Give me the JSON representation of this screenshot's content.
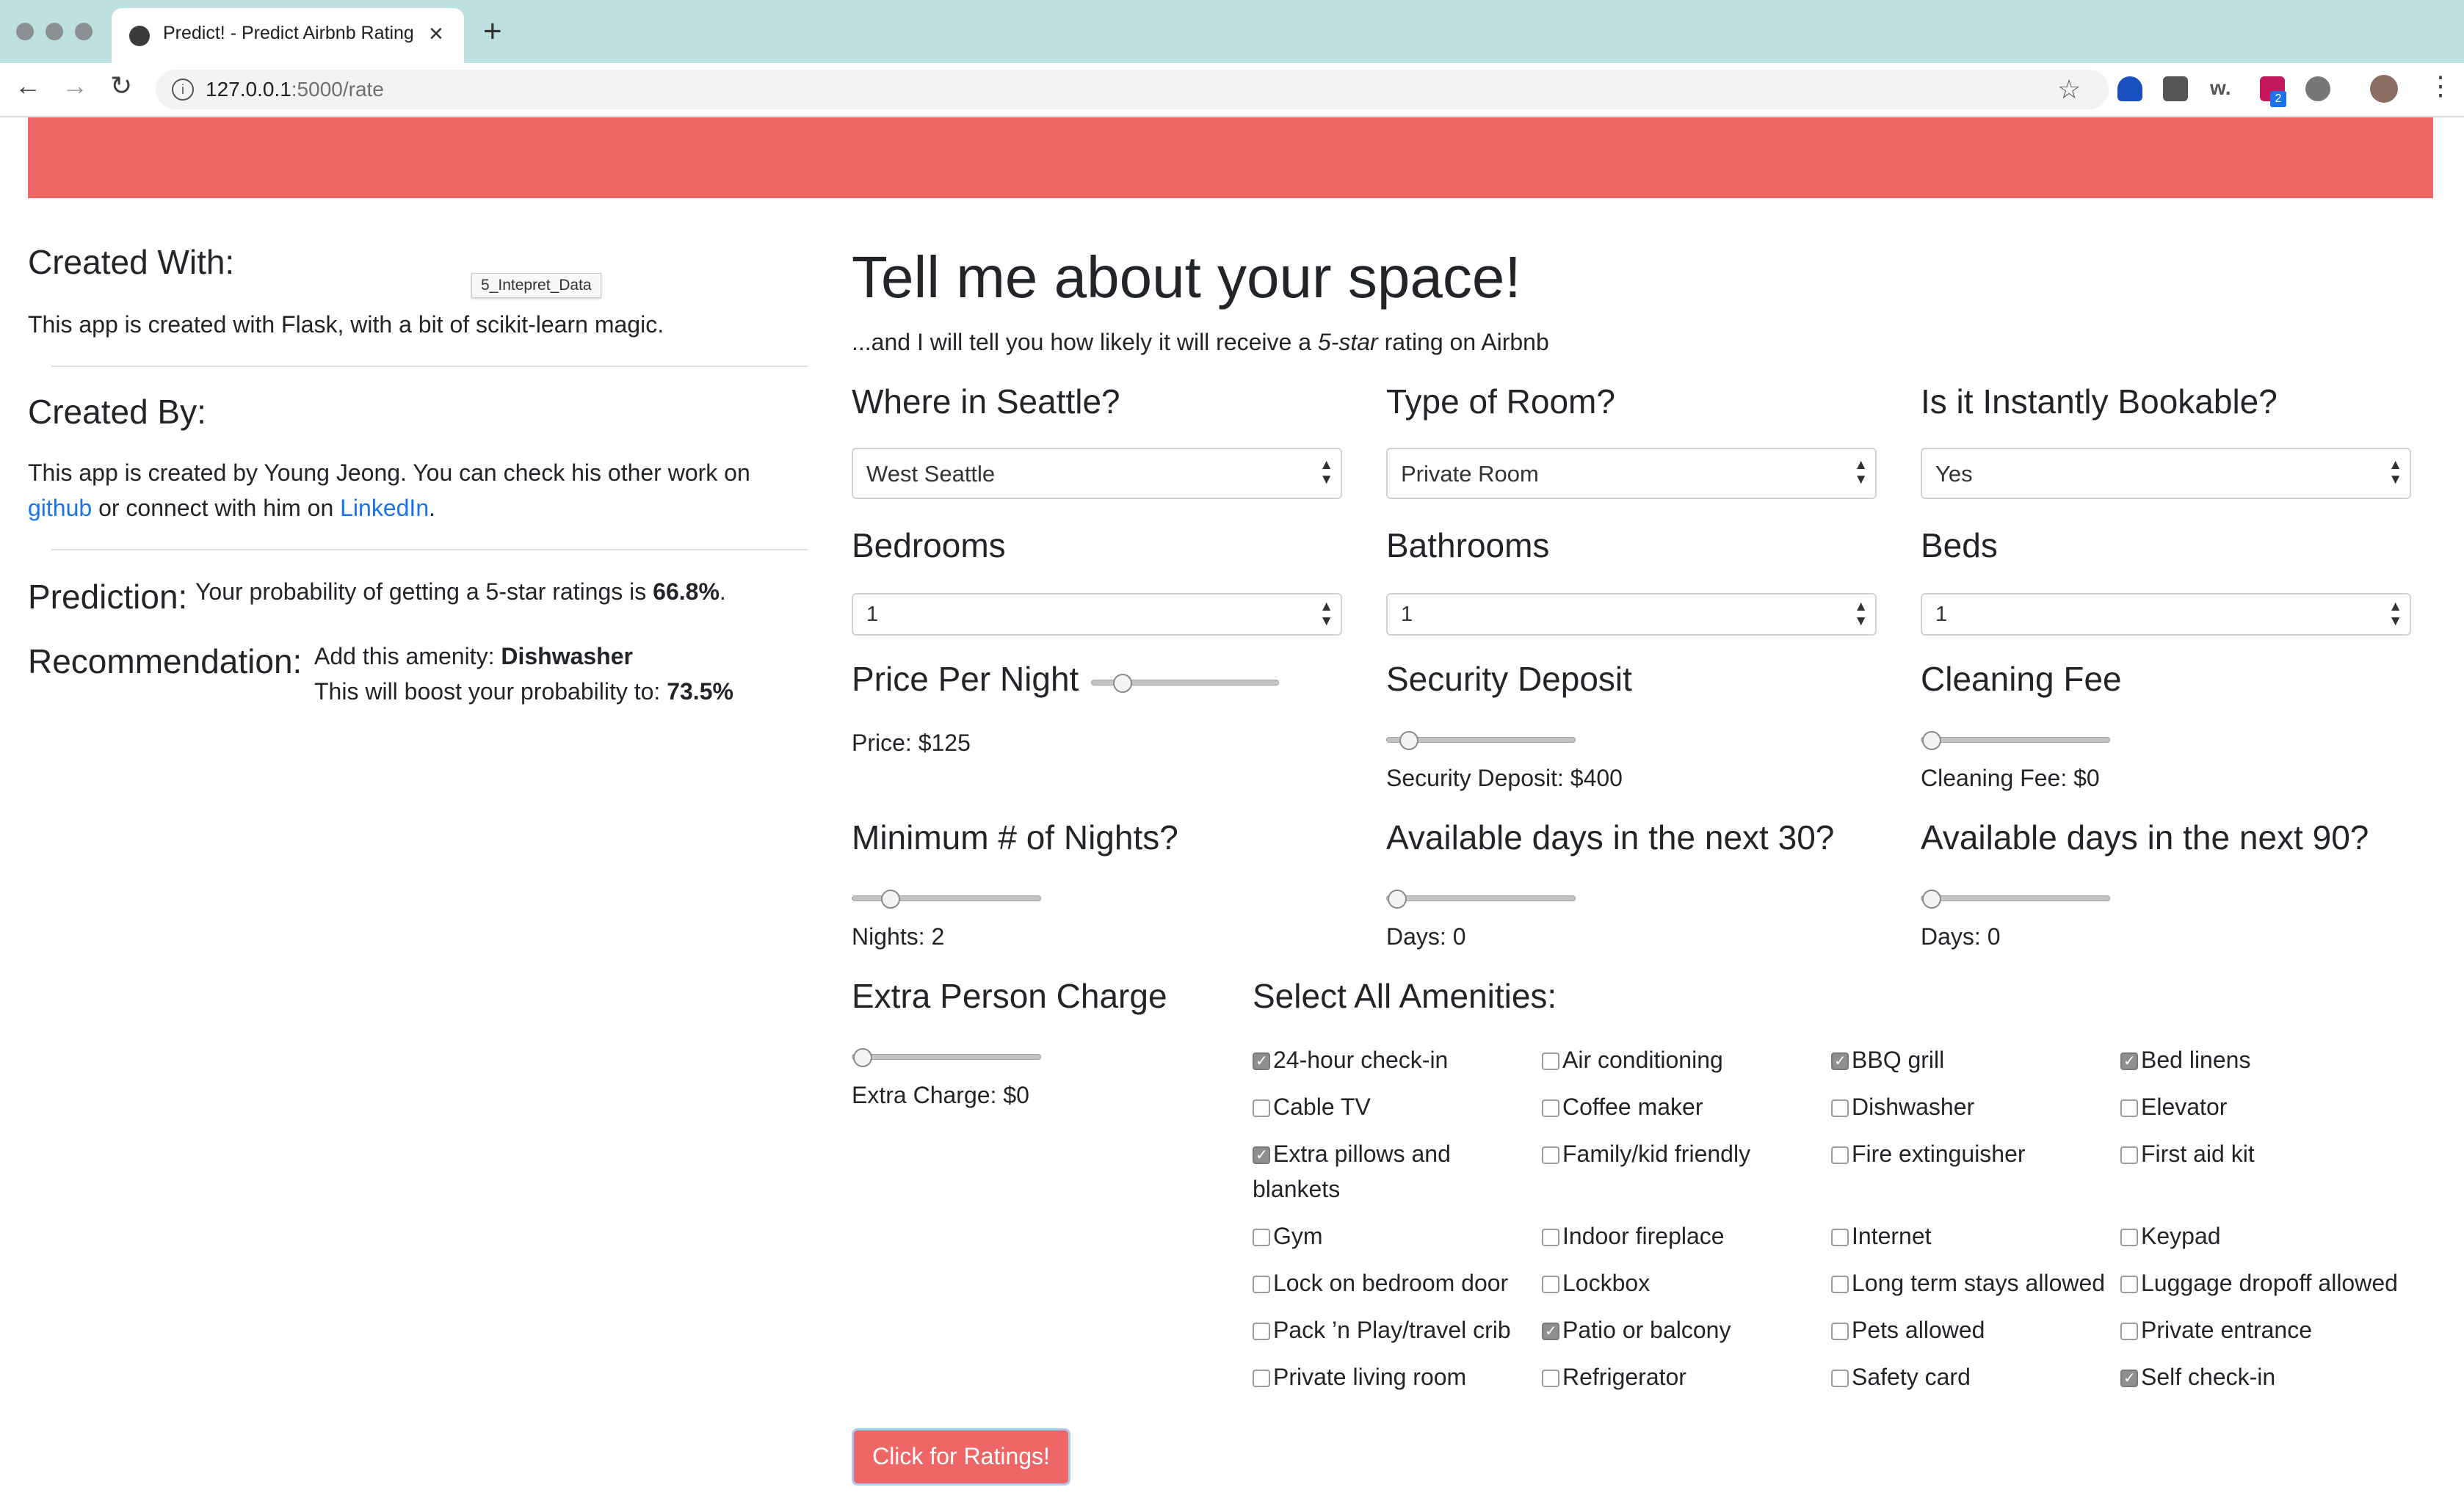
{
  "browser": {
    "tab_title": "Predict! - Predict Airbnb Ratings",
    "tab_close": "×",
    "new_tab": "+",
    "url_host": "127.0.0.1",
    "url_path": ":5000/rate",
    "back": "←",
    "forward": "→",
    "reload": "↻",
    "bookmark": "☆",
    "menu": "⋮",
    "extensions": [
      "shield-icon",
      "screen-icon",
      "w-icon",
      "badge-icon",
      "circle-icon",
      "avatar"
    ],
    "extension_badge": "2"
  },
  "colors": {
    "banner": "#ee6666",
    "link": "#1a73e8",
    "button": "#ee6666"
  },
  "sidebar": {
    "created_with_title": "Created With:",
    "created_with_text": "This app is created with Flask, with a bit of scikit-learn magic.",
    "tooltip": "5_Intepret_Data",
    "created_by_title": "Created By:",
    "created_by_text_1": "This app is created by Young Jeong. You can check his other work on",
    "github_link": "github",
    "created_by_text_2": " or connect with him on ",
    "linkedin_link": "LinkedIn",
    "created_by_text_3": ".",
    "prediction_title": "Prediction:",
    "prediction_text": "Your probability of getting a 5-star ratings is ",
    "prediction_value": "66.8%",
    "prediction_end": ".",
    "recommendation_title": "Recommendation:",
    "recommendation_text_1": "Add this amenity: ",
    "recommendation_amenity": "Dishwasher",
    "recommendation_text_2": "This will boost your probability to: ",
    "recommendation_value": "73.5%"
  },
  "main": {
    "heading": "Tell me about your space!",
    "subtitle_1": "...and I will tell you how likely it will receive a ",
    "subtitle_em": "5-star",
    "subtitle_2": " rating on Airbnb",
    "selects": [
      {
        "label": "Where in Seattle?",
        "value": "West Seattle"
      },
      {
        "label": "Type of Room?",
        "value": "Private Room"
      },
      {
        "label": "Is it Instantly Bookable?",
        "value": "Yes"
      },
      {
        "label": "Bedrooms",
        "value": "1"
      },
      {
        "label": "Bathrooms",
        "value": "1"
      },
      {
        "label": "Beds",
        "value": "1"
      }
    ],
    "sliders": [
      {
        "label": "Price Per Night",
        "readout": "Price: $125"
      },
      {
        "label": "Security Deposit",
        "readout": "Security Deposit: $400"
      },
      {
        "label": "Cleaning Fee",
        "readout": "Cleaning Fee: $0"
      },
      {
        "label": "Minimum # of Nights?",
        "readout": "Nights: 2"
      },
      {
        "label": "Available days in the next 30?",
        "readout": "Days: 0"
      },
      {
        "label": "Available days in the next 90?",
        "readout": "Days: 0"
      },
      {
        "label": "Extra Person Charge",
        "readout": "Extra Charge: $0"
      }
    ],
    "amenities_title": "Select All Amenities:",
    "amenities": [
      {
        "label": "24-hour check-in",
        "checked": true
      },
      {
        "label": "Air conditioning",
        "checked": false
      },
      {
        "label": "BBQ grill",
        "checked": true
      },
      {
        "label": "Bed linens",
        "checked": true
      },
      {
        "label": "Cable TV",
        "checked": false
      },
      {
        "label": "Coffee maker",
        "checked": false
      },
      {
        "label": "Dishwasher",
        "checked": false
      },
      {
        "label": "Elevator",
        "checked": false
      },
      {
        "label": "Extra pillows and",
        "label_2": "blankets",
        "checked": true
      },
      {
        "label": "Family/kid friendly",
        "checked": false
      },
      {
        "label": "Fire extinguisher",
        "checked": false
      },
      {
        "label": "First aid kit",
        "checked": false
      },
      {
        "label": "Gym",
        "checked": false
      },
      {
        "label": "Indoor fireplace",
        "checked": false
      },
      {
        "label": "Internet",
        "checked": false
      },
      {
        "label": "Keypad",
        "checked": false
      },
      {
        "label": "Lock on bedroom door",
        "checked": false
      },
      {
        "label": "Lockbox",
        "checked": false
      },
      {
        "label": "Long term stays allowed",
        "checked": false
      },
      {
        "label": "Luggage dropoff allowed",
        "checked": false
      },
      {
        "label": "Pack ’n Play/travel crib",
        "checked": false
      },
      {
        "label": "Patio or balcony",
        "checked": true
      },
      {
        "label": "Pets allowed",
        "checked": false
      },
      {
        "label": "Private entrance",
        "checked": false
      },
      {
        "label": "Private living room",
        "checked": false
      },
      {
        "label": "Refrigerator",
        "checked": false
      },
      {
        "label": "Safety card",
        "checked": false
      },
      {
        "label": "Self check-in",
        "checked": true
      }
    ],
    "submit_label": "Click for Ratings!"
  }
}
